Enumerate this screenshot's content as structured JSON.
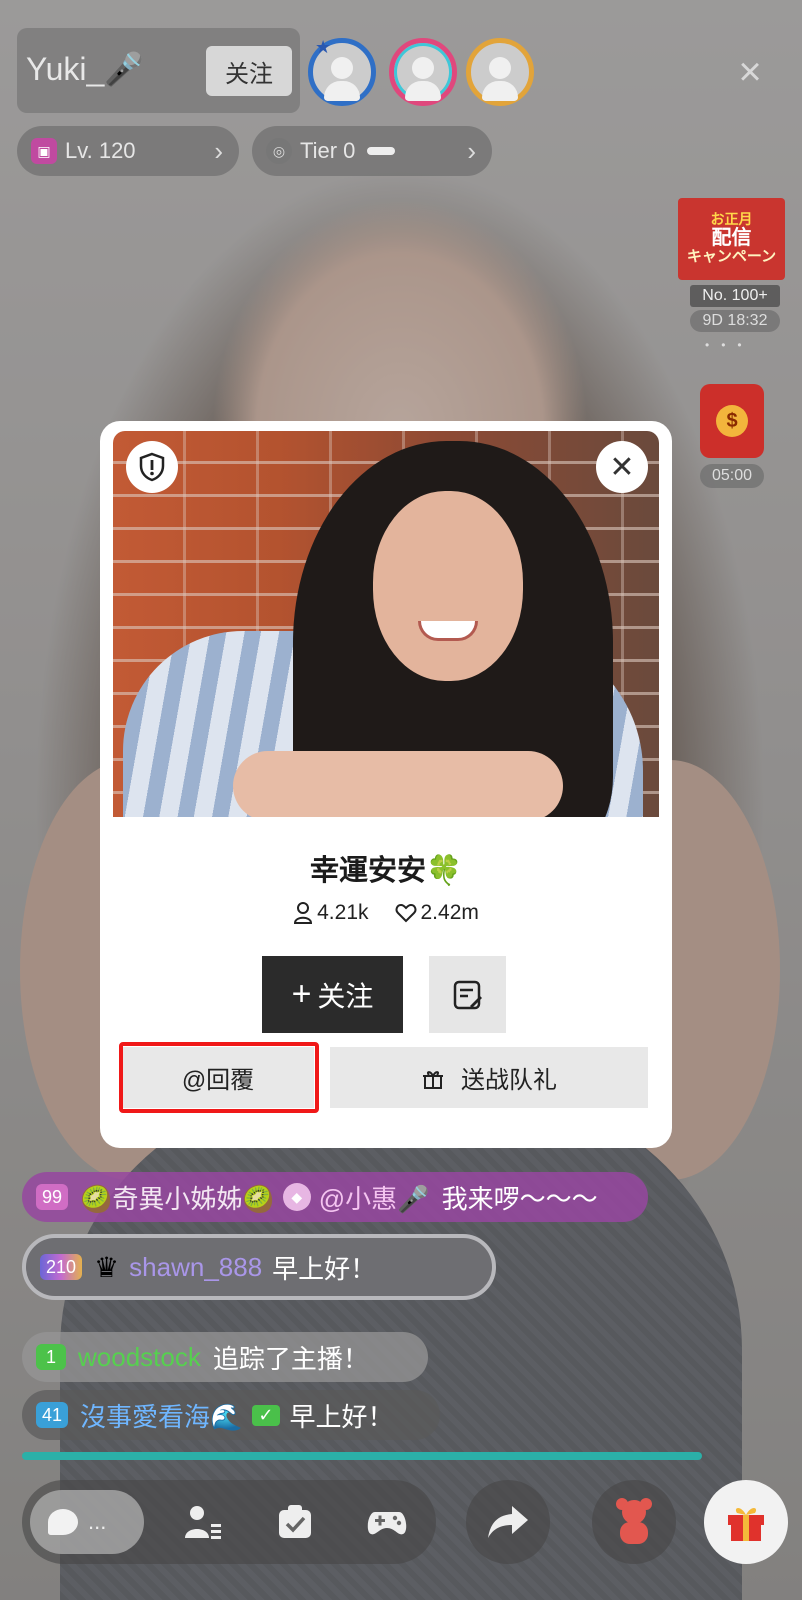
{
  "host": {
    "name": "Yuki_🎤",
    "follow_label": "关注"
  },
  "level_pill": {
    "label": "Lv. 120"
  },
  "tier_pill": {
    "label": "Tier 0"
  },
  "campaign": {
    "title_lines": [
      "お正月",
      "配信",
      "キャンペーン"
    ],
    "rank": "No. 100+",
    "timer": "9D 18:32"
  },
  "red_packet": {
    "timer": "05:00"
  },
  "profile": {
    "nickname": "幸運安安🍀",
    "followers": "4.21k",
    "likes": "2.42m",
    "follow_label": "关注",
    "reply_label": "@回覆",
    "gift_label": "送战队礼"
  },
  "chat": [
    {
      "level": "99",
      "user": "🥝奇異小姊姊🥝",
      "mention": "@小惠🎤",
      "text": "我来啰～～～"
    },
    {
      "level": "210",
      "user": "shawn_888",
      "text": "早上好！"
    },
    {
      "level": "1",
      "user": "woodstock",
      "text": "追踪了主播！"
    },
    {
      "level": "41",
      "user": "沒事愛看海🌊",
      "text": "早上好！"
    }
  ],
  "bottom": {
    "input_placeholder": "..."
  },
  "colors": {
    "follow_dark": "#2b2b2b",
    "highlight_red": "#f01818",
    "gift_red": "#e0322c"
  }
}
